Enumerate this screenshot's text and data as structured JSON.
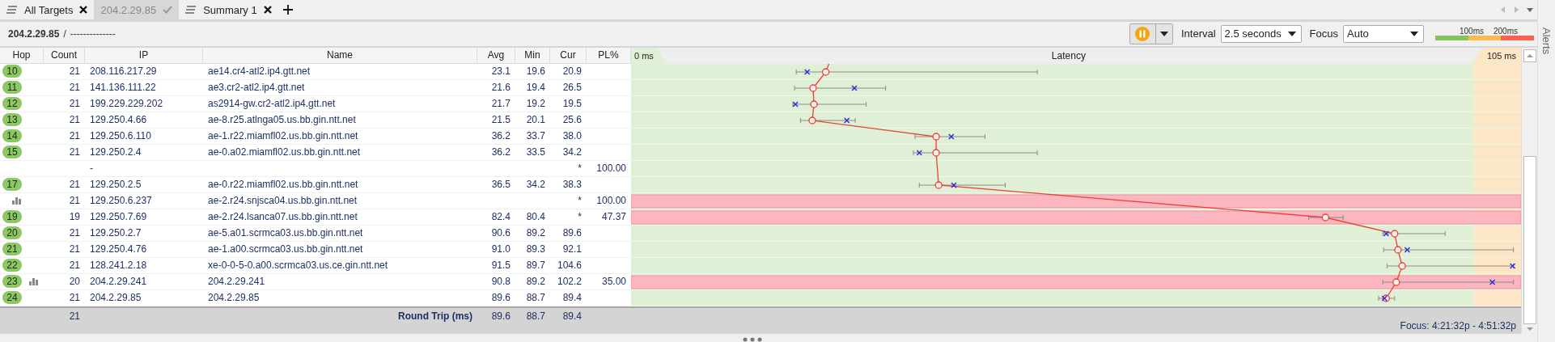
{
  "tabs": [
    {
      "label": "All Targets",
      "selected": false
    },
    {
      "label": "204.2.29.85",
      "selected": true
    },
    {
      "label": "Summary 1",
      "selected": false
    }
  ],
  "toolbar": {
    "target": "204.2.29.85",
    "separator": "/",
    "path": "--------------",
    "interval": {
      "label": "Interval",
      "value": "2.5 seconds"
    },
    "focus": {
      "label": "Focus",
      "value": "Auto"
    },
    "legend": {
      "labels": [
        "100ms",
        "200ms"
      ],
      "segments": [
        {
          "color": "#86c25e"
        },
        {
          "color": "#fcbb4e"
        },
        {
          "color": "#f6634f"
        }
      ]
    }
  },
  "alerts": "Alerts",
  "table": {
    "columns": [
      "Hop",
      "Count",
      "IP",
      "Name",
      "Avg",
      "Min",
      "Cur",
      "PL%"
    ],
    "rows": [
      {
        "hop": "10",
        "graph_icon": false,
        "count": "21",
        "ip": "208.116.217.29",
        "name": "ae14.cr4-atl2.ip4.gtt.net",
        "avg": "23.1",
        "min": "19.6",
        "cur": "20.9",
        "highlighted": false
      },
      {
        "hop": "11",
        "graph_icon": false,
        "count": "21",
        "ip": "141.136.111.22",
        "name": "ae3.cr2-atl2.ip4.gtt.net",
        "avg": "21.6",
        "min": "19.4",
        "cur": "26.5",
        "highlighted": false
      },
      {
        "hop": "12",
        "graph_icon": false,
        "count": "21",
        "ip": "199.229.229.202",
        "name": "as2914-gw.cr2-atl2.ip4.gtt.net",
        "avg": "21.7",
        "min": "19.2",
        "cur": "19.5",
        "highlighted": false
      },
      {
        "hop": "13",
        "graph_icon": false,
        "count": "21",
        "ip": "129.250.4.66",
        "name": "ae-8.r25.atlnga05.us.bb.gin.ntt.net",
        "avg": "21.5",
        "min": "20.1",
        "cur": "25.6",
        "highlighted": false
      },
      {
        "hop": "14",
        "graph_icon": false,
        "count": "21",
        "ip": "129.250.6.110",
        "name": "ae-1.r22.miamfl02.us.bb.gin.ntt.net",
        "avg": "36.2",
        "min": "33.7",
        "cur": "38.0",
        "highlighted": false
      },
      {
        "hop": "15",
        "graph_icon": false,
        "count": "21",
        "ip": "129.250.2.4",
        "name": "ae-0.a02.miamfl02.us.bb.gin.ntt.net",
        "avg": "36.2",
        "min": "33.5",
        "cur": "34.2",
        "highlighted": false
      },
      {
        "graph_icon": false,
        "ip": "-",
        "cur": "*",
        "pl": "100.00",
        "highlighted": false
      },
      {
        "hop": "17",
        "graph_icon": false,
        "count": "21",
        "ip": "129.250.2.5",
        "name": "ae-0.r22.miamfl02.us.bb.gin.ntt.net",
        "avg": "36.5",
        "min": "34.2",
        "cur": "38.3",
        "highlighted": false
      },
      {
        "graph_icon": true,
        "count": "21",
        "ip": "129.250.6.237",
        "name": "ae-2.r24.snjsca04.us.bb.gin.ntt.net",
        "cur": "*",
        "pl": "100.00",
        "highlighted": true
      },
      {
        "hop": "19",
        "graph_icon": false,
        "count": "19",
        "ip": "129.250.7.69",
        "name": "ae-2.r24.lsanca07.us.bb.gin.ntt.net",
        "avg": "82.4",
        "min": "80.4",
        "cur": "*",
        "pl": "47.37",
        "highlighted": true
      },
      {
        "hop": "20",
        "graph_icon": false,
        "count": "21",
        "ip": "129.250.2.7",
        "name": "ae-5.a01.scrmca03.us.bb.gin.ntt.net",
        "avg": "90.6",
        "min": "89.2",
        "cur": "89.6",
        "highlighted": false
      },
      {
        "hop": "21",
        "graph_icon": false,
        "count": "21",
        "ip": "129.250.4.76",
        "name": "ae-1.a00.scrmca03.us.bb.gin.ntt.net",
        "avg": "91.0",
        "min": "89.3",
        "cur": "92.1",
        "highlighted": false
      },
      {
        "hop": "22",
        "graph_icon": false,
        "count": "21",
        "ip": "128.241.2.18",
        "name": "xe-0-0-5-0.a00.scrmca03.us.ce.gin.ntt.net",
        "avg": "91.5",
        "min": "89.7",
        "cur": "104.6",
        "highlighted": false
      },
      {
        "hop": "23",
        "graph_icon": true,
        "count": "20",
        "ip": "204.2.29.241",
        "name": "204.2.29.241",
        "avg": "90.8",
        "min": "89.2",
        "cur": "102.2",
        "pl": "35.00",
        "highlighted": true
      },
      {
        "hop": "24",
        "graph_icon": false,
        "count": "21",
        "ip": "204.2.29.85",
        "name": "204.2.29.85",
        "avg": "89.6",
        "min": "88.7",
        "cur": "89.4",
        "highlighted": false
      }
    ],
    "footer": {
      "count": "21",
      "label": "Round Trip (ms)",
      "avg": "89.6",
      "min": "88.7",
      "cur": "89.4"
    }
  },
  "latency": {
    "title": "Latency",
    "axis_start": "0 ms",
    "axis_end": "105 ms",
    "focus_range": "Focus: 4:21:32p - 4:51:32p"
  }
}
